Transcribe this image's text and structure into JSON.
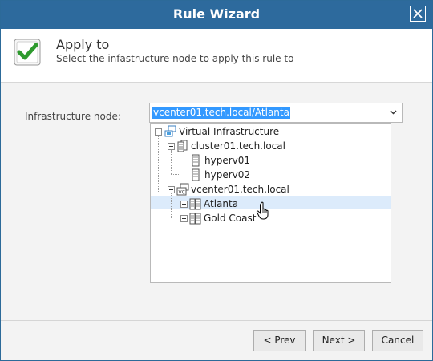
{
  "window": {
    "title": "Rule Wizard"
  },
  "header": {
    "title": "Apply to",
    "subtitle": "Select the infastructure node to apply this rule to",
    "icon": "check-icon"
  },
  "form": {
    "label": "Infrastructure node:",
    "value": "vcenter01.tech.local/Atlanta"
  },
  "tree": {
    "root": "Virtual Infrastructure",
    "cluster": "cluster01.tech.local",
    "host1": "hyperv01",
    "host2": "hyperv02",
    "vcenter": "vcenter01.tech.local",
    "dc1": "Atlanta",
    "dc2": "Gold Coast"
  },
  "buttons": {
    "prev": "< Prev",
    "next": "Next >",
    "cancel": "Cancel"
  },
  "colors": {
    "titlebar": "#2d6a9d",
    "selection": "#3399ff",
    "hover": "#dcebfb"
  }
}
